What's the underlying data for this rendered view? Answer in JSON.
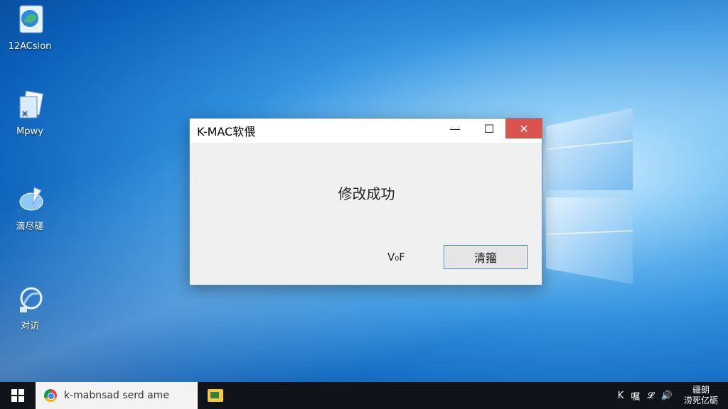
{
  "desktop": {
    "icons": [
      {
        "label": "12ACsion",
        "icon": "app-icon"
      },
      {
        "label": "Mpwy",
        "icon": "document-icon"
      },
      {
        "label": "滴尽磋",
        "icon": "paint-icon"
      },
      {
        "label": "对访",
        "icon": "globe-icon"
      }
    ]
  },
  "dialog": {
    "title": "K-MAC软偎",
    "message": "修改成功",
    "secondary_label": "V₀F",
    "primary_button": "清籀",
    "controls": {
      "minimize": "—",
      "maximize": "☐",
      "close": "✕"
    }
  },
  "taskbar": {
    "search_text": "k-mabnsad serd ame",
    "tray_items": [
      "K",
      "嘱",
      "𝓛",
      "🔊"
    ],
    "clock_line1": "疆朗",
    "clock_line2": "涝死亿砺"
  },
  "colors": {
    "close_button": "#d9534f",
    "taskbar": "#10131a",
    "dialog_border": "#5b8fc7"
  }
}
